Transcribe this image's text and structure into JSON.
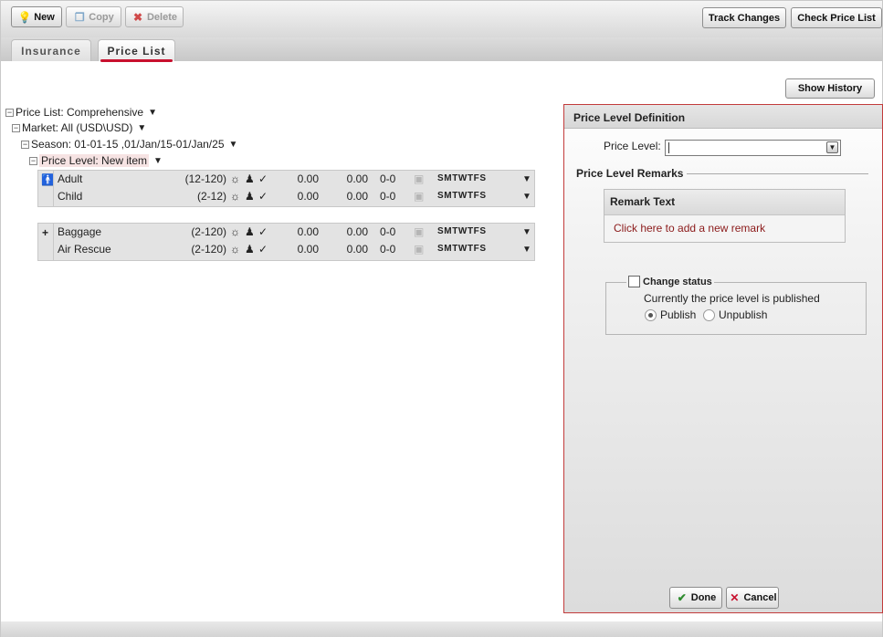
{
  "toolbar": {
    "new_label": "New",
    "copy_label": "Copy",
    "delete_label": "Delete",
    "track_changes_label": "Track Changes",
    "check_price_list_label": "Check Price List"
  },
  "tabs": [
    {
      "label": "Insurance",
      "active": false
    },
    {
      "label": "Price List",
      "active": true
    }
  ],
  "show_history_label": "Show History",
  "tree": {
    "price_list": "Price List: Comprehensive",
    "market": "Market: All (USD\\USD)",
    "season": "Season: 01-01-15 ,01/Jan/15-01/Jan/25",
    "price_level_prefix": "Price Level: ",
    "price_level_name": "New item"
  },
  "groups": [
    {
      "rows": [
        {
          "name": "Adult",
          "range": "(12-120)",
          "v1": "0.00",
          "v2": "0.00",
          "v3": "0-0",
          "days": "SMTWTFS"
        },
        {
          "name": "Child",
          "range": "(2-12)",
          "v1": "0.00",
          "v2": "0.00",
          "v3": "0-0",
          "days": "SMTWTFS"
        }
      ]
    },
    {
      "rows": [
        {
          "name": "Baggage",
          "range": "(2-120)",
          "v1": "0.00",
          "v2": "0.00",
          "v3": "0-0",
          "days": "SMTWTFS"
        },
        {
          "name": "Air Rescue",
          "range": "(2-120)",
          "v1": "0.00",
          "v2": "0.00",
          "v3": "0-0",
          "days": "SMTWTFS"
        }
      ]
    }
  ],
  "panel": {
    "title": "Price Level Definition",
    "price_level_label": "Price Level:",
    "price_level_value": "",
    "remarks_title": "Price Level Remarks",
    "remark_text_header": "Remark Text",
    "remark_add_link": "Click here to add a new remark",
    "change_status_label": "Change status",
    "status_text": "Currently the price level is published",
    "publish_label": "Publish",
    "unpublish_label": "Unpublish",
    "publish_selected": true,
    "done_label": "Done",
    "cancel_label": "Cancel"
  },
  "colors": {
    "accent": "#c8102e",
    "panel_border": "#c23b3b",
    "link": "#8b1a1a"
  }
}
